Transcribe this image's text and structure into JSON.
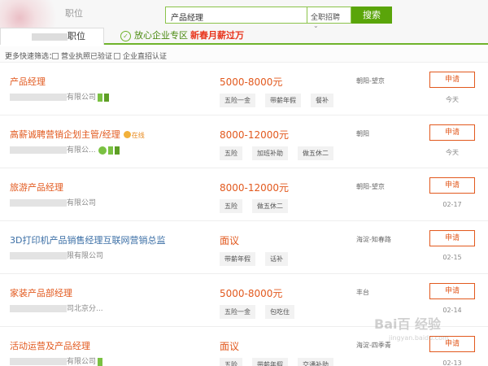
{
  "header": {
    "top_tab": "职位",
    "search_value": "产品经理",
    "search_scope": "全职招聘",
    "search_button": "搜索"
  },
  "tabs": [
    {
      "label": "职位"
    },
    {
      "label": "放心企业专区"
    },
    {
      "label": "新春月薪过万"
    }
  ],
  "filters": {
    "label": "更多快速筛选：",
    "options": [
      "营业执照已验证",
      "企业直招认证"
    ]
  },
  "jobs": [
    {
      "title": "产品经理",
      "company": "有限公司",
      "salary": "5000-8000元",
      "tags": [
        "五险一金",
        "带薪年假",
        "餐补"
      ],
      "location": "朝阳-望京",
      "apply": "申请",
      "date": "今天"
    },
    {
      "title": "高薪诚聘营销企划主管/经理",
      "online": "在线",
      "company": "有限公...",
      "salary": "8000-12000元",
      "tags": [
        "五险",
        "加班补助",
        "做五休二"
      ],
      "location": "朝阳",
      "apply": "申请",
      "date": "今天"
    },
    {
      "title": "旅游产品经理",
      "company": "有限公司",
      "salary": "8000-12000元",
      "tags": [
        "五险",
        "做五休二"
      ],
      "location": "朝阳-望京",
      "apply": "申请",
      "date": "02-17"
    },
    {
      "title": "3D打印机产品销售经理互联网营销总监",
      "company": "限有限公司",
      "salary": "面议",
      "tags": [
        "带薪年假",
        "话补"
      ],
      "location": "海淀-知春路",
      "apply": "申请",
      "date": "02-15"
    },
    {
      "title": "家装产品部经理",
      "company": "司北京分...",
      "salary": "5000-8000元",
      "tags": [
        "五险一金",
        "包吃住"
      ],
      "location": "丰台",
      "apply": "申请",
      "date": "02-14"
    },
    {
      "title": "活动运营及产品经理",
      "company": "有限公司",
      "salary": "面议",
      "tags": [
        "五险",
        "带薪年假",
        "交通补助"
      ],
      "location": "海淀-四季青",
      "apply": "申请",
      "date": "02-13"
    }
  ],
  "watermark": {
    "text": "Bai百 经验",
    "sub": "jingyan.baidu.com"
  },
  "colors": {
    "accent": "#5aa50a",
    "highlight": "#e2591e",
    "link": "#3a6ea5"
  }
}
